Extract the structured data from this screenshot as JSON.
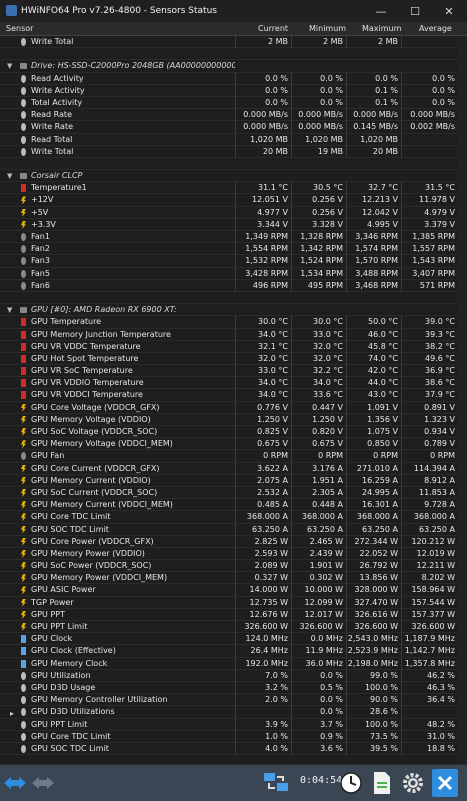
{
  "window": {
    "title": "HWiNFO64 Pro v7.26-4800 - Sensors Status"
  },
  "columns": {
    "sensor": "Sensor",
    "current": "Current",
    "minimum": "Minimum",
    "maximum": "Maximum",
    "average": "Average"
  },
  "rows": [
    {
      "t": "row",
      "icon": "circle",
      "name": "Write Total",
      "cur": "2 MB",
      "min": "2 MB",
      "max": "2 MB",
      "avg": ""
    },
    {
      "t": "blank"
    },
    {
      "t": "group",
      "icon": "drive",
      "name": "Drive: HS-SSD-C2000Pro 2048GB (AA000000000000000271)"
    },
    {
      "t": "row",
      "icon": "circle",
      "name": "Read Activity",
      "cur": "0.0 %",
      "min": "0.0 %",
      "max": "0.0 %",
      "avg": "0.0 %"
    },
    {
      "t": "row",
      "icon": "circle",
      "name": "Write Activity",
      "cur": "0.0 %",
      "min": "0.0 %",
      "max": "0.1 %",
      "avg": "0.0 %"
    },
    {
      "t": "row",
      "icon": "circle",
      "name": "Total Activity",
      "cur": "0.0 %",
      "min": "0.0 %",
      "max": "0.1 %",
      "avg": "0.0 %"
    },
    {
      "t": "row",
      "icon": "circle",
      "name": "Read Rate",
      "cur": "0.000 MB/s",
      "min": "0.000 MB/s",
      "max": "0.000 MB/s",
      "avg": "0.000 MB/s"
    },
    {
      "t": "row",
      "icon": "circle",
      "name": "Write Rate",
      "cur": "0.000 MB/s",
      "min": "0.000 MB/s",
      "max": "0.145 MB/s",
      "avg": "0.002 MB/s"
    },
    {
      "t": "row",
      "icon": "circle",
      "name": "Read Total",
      "cur": "1,020 MB",
      "min": "1,020 MB",
      "max": "1,020 MB",
      "avg": ""
    },
    {
      "t": "row",
      "icon": "circle",
      "name": "Write Total",
      "cur": "20 MB",
      "min": "19 MB",
      "max": "20 MB",
      "avg": ""
    },
    {
      "t": "blank"
    },
    {
      "t": "group",
      "icon": "drive",
      "name": "Corsair CLCP"
    },
    {
      "t": "row",
      "icon": "temp",
      "name": "Temperature1",
      "cur": "31.1 °C",
      "min": "30.5 °C",
      "max": "32.7 °C",
      "avg": "31.5 °C"
    },
    {
      "t": "row",
      "icon": "volt",
      "name": "+12V",
      "cur": "12.051 V",
      "min": "0.256 V",
      "max": "12.213 V",
      "avg": "11.978 V"
    },
    {
      "t": "row",
      "icon": "volt",
      "name": "+5V",
      "cur": "4.977 V",
      "min": "0.256 V",
      "max": "12.042 V",
      "avg": "4.979 V"
    },
    {
      "t": "row",
      "icon": "volt",
      "name": "+3.3V",
      "cur": "3.344 V",
      "min": "3.328 V",
      "max": "4.995 V",
      "avg": "3.379 V"
    },
    {
      "t": "row",
      "icon": "fan",
      "name": "Fan1",
      "cur": "1,349 RPM",
      "min": "1,328 RPM",
      "max": "3,346 RPM",
      "avg": "1,385 RPM"
    },
    {
      "t": "row",
      "icon": "fan",
      "name": "Fan2",
      "cur": "1,554 RPM",
      "min": "1,342 RPM",
      "max": "1,574 RPM",
      "avg": "1,557 RPM"
    },
    {
      "t": "row",
      "icon": "fan",
      "name": "Fan3",
      "cur": "1,532 RPM",
      "min": "1,524 RPM",
      "max": "1,570 RPM",
      "avg": "1,543 RPM"
    },
    {
      "t": "row",
      "icon": "fan",
      "name": "Fan5",
      "cur": "3,428 RPM",
      "min": "1,534 RPM",
      "max": "3,488 RPM",
      "avg": "3,407 RPM"
    },
    {
      "t": "row",
      "icon": "fan",
      "name": "Fan6",
      "cur": "496 RPM",
      "min": "495 RPM",
      "max": "3,468 RPM",
      "avg": "571 RPM"
    },
    {
      "t": "blank"
    },
    {
      "t": "group",
      "icon": "gpu",
      "name": "GPU [#0]: AMD Radeon RX 6900 XT:"
    },
    {
      "t": "row",
      "icon": "temp",
      "name": "GPU Temperature",
      "cur": "30.0 °C",
      "min": "30.0 °C",
      "max": "50.0 °C",
      "avg": "39.0 °C"
    },
    {
      "t": "row",
      "icon": "temp",
      "name": "GPU Memory Junction Temperature",
      "cur": "34.0 °C",
      "min": "33.0 °C",
      "max": "46.0 °C",
      "avg": "39.3 °C"
    },
    {
      "t": "row",
      "icon": "temp",
      "name": "GPU VR VDDC Temperature",
      "cur": "32.1 °C",
      "min": "32.0 °C",
      "max": "45.8 °C",
      "avg": "38.2 °C"
    },
    {
      "t": "row",
      "icon": "temp",
      "name": "GPU Hot Spot Temperature",
      "cur": "32.0 °C",
      "min": "32.0 °C",
      "max": "74.0 °C",
      "avg": "49.6 °C"
    },
    {
      "t": "row",
      "icon": "temp",
      "name": "GPU VR SoC Temperature",
      "cur": "33.0 °C",
      "min": "32.2 °C",
      "max": "42.0 °C",
      "avg": "36.9 °C"
    },
    {
      "t": "row",
      "icon": "temp",
      "name": "GPU VR VDDIO Temperature",
      "cur": "34.0 °C",
      "min": "34.0 °C",
      "max": "44.0 °C",
      "avg": "38.6 °C"
    },
    {
      "t": "row",
      "icon": "temp",
      "name": "GPU VR VDDCI Temperature",
      "cur": "34.0 °C",
      "min": "33.6 °C",
      "max": "43.0 °C",
      "avg": "37.9 °C"
    },
    {
      "t": "row",
      "icon": "volt",
      "name": "GPU Core Voltage (VDDCR_GFX)",
      "cur": "0.776 V",
      "min": "0.447 V",
      "max": "1.091 V",
      "avg": "0.891 V"
    },
    {
      "t": "row",
      "icon": "volt",
      "name": "GPU Memory Voltage (VDDIO)",
      "cur": "1.250 V",
      "min": "1.250 V",
      "max": "1.356 V",
      "avg": "1.323 V"
    },
    {
      "t": "row",
      "icon": "volt",
      "name": "GPU SoC Voltage (VDDCR_SOC)",
      "cur": "0.825 V",
      "min": "0.820 V",
      "max": "1.075 V",
      "avg": "0.934 V"
    },
    {
      "t": "row",
      "icon": "volt",
      "name": "GPU Memory Voltage (VDDCI_MEM)",
      "cur": "0.675 V",
      "min": "0.675 V",
      "max": "0.850 V",
      "avg": "0.789 V"
    },
    {
      "t": "row",
      "icon": "fan",
      "name": "GPU Fan",
      "cur": "0 RPM",
      "min": "0 RPM",
      "max": "0 RPM",
      "avg": "0 RPM"
    },
    {
      "t": "row",
      "icon": "volt",
      "name": "GPU Core Current (VDDCR_GFX)",
      "cur": "3.622 A",
      "min": "3.176 A",
      "max": "271.010 A",
      "avg": "114.394 A"
    },
    {
      "t": "row",
      "icon": "volt",
      "name": "GPU Memory Current (VDDIO)",
      "cur": "2.075 A",
      "min": "1.951 A",
      "max": "16.259 A",
      "avg": "8.912 A"
    },
    {
      "t": "row",
      "icon": "volt",
      "name": "GPU SoC Current (VDDCR_SOC)",
      "cur": "2.532 A",
      "min": "2.305 A",
      "max": "24.995 A",
      "avg": "11.853 A"
    },
    {
      "t": "row",
      "icon": "volt",
      "name": "GPU Memory Current (VDDCI_MEM)",
      "cur": "0.485 A",
      "min": "0.448 A",
      "max": "16.301 A",
      "avg": "9.728 A"
    },
    {
      "t": "row",
      "icon": "volt",
      "name": "GPU Core TDC Limit",
      "cur": "368.000 A",
      "min": "368.000 A",
      "max": "368.000 A",
      "avg": "368.000 A"
    },
    {
      "t": "row",
      "icon": "volt",
      "name": "GPU SOC TDC Limit",
      "cur": "63.250 A",
      "min": "63.250 A",
      "max": "63.250 A",
      "avg": "63.250 A"
    },
    {
      "t": "row",
      "icon": "volt",
      "name": "GPU Core Power (VDDCR_GFX)",
      "cur": "2.825 W",
      "min": "2.465 W",
      "max": "272.344 W",
      "avg": "120.212 W"
    },
    {
      "t": "row",
      "icon": "volt",
      "name": "GPU Memory Power (VDDIO)",
      "cur": "2.593 W",
      "min": "2.439 W",
      "max": "22.052 W",
      "avg": "12.019 W"
    },
    {
      "t": "row",
      "icon": "volt",
      "name": "GPU SoC Power (VDDCR_SOC)",
      "cur": "2.089 W",
      "min": "1.901 W",
      "max": "26.792 W",
      "avg": "12.211 W"
    },
    {
      "t": "row",
      "icon": "volt",
      "name": "GPU Memory Power (VDDCI_MEM)",
      "cur": "0.327 W",
      "min": "0.302 W",
      "max": "13.856 W",
      "avg": "8.202 W"
    },
    {
      "t": "row",
      "icon": "volt",
      "name": "GPU ASIC Power",
      "cur": "14.000 W",
      "min": "10.000 W",
      "max": "328.000 W",
      "avg": "158.964 W"
    },
    {
      "t": "row",
      "icon": "volt",
      "name": "TGP Power",
      "cur": "12.735 W",
      "min": "12.099 W",
      "max": "327.470 W",
      "avg": "157.544 W"
    },
    {
      "t": "row",
      "icon": "volt",
      "name": "GPU PPT",
      "cur": "12.676 W",
      "min": "12.017 W",
      "max": "326.616 W",
      "avg": "157.377 W"
    },
    {
      "t": "row",
      "icon": "volt",
      "name": "GPU PPT Limit",
      "cur": "326.600 W",
      "min": "326.600 W",
      "max": "326.600 W",
      "avg": "326.600 W"
    },
    {
      "t": "row",
      "icon": "clock",
      "name": "GPU Clock",
      "cur": "124.0 MHz",
      "min": "0.0 MHz",
      "max": "2,543.0 MHz",
      "avg": "1,187.9 MHz"
    },
    {
      "t": "row",
      "icon": "clock",
      "name": "GPU Clock (Effective)",
      "cur": "26.4 MHz",
      "min": "11.9 MHz",
      "max": "2,523.9 MHz",
      "avg": "1,142.7 MHz"
    },
    {
      "t": "row",
      "icon": "clock",
      "name": "GPU Memory Clock",
      "cur": "192.0 MHz",
      "min": "36.0 MHz",
      "max": "2,198.0 MHz",
      "avg": "1,357.8 MHz"
    },
    {
      "t": "row",
      "icon": "percent",
      "name": "GPU Utilization",
      "cur": "7.0 %",
      "min": "0.0 %",
      "max": "99.0 %",
      "avg": "46.2 %"
    },
    {
      "t": "row",
      "icon": "percent",
      "name": "GPU D3D Usage",
      "cur": "3.2 %",
      "min": "0.5 %",
      "max": "100.0 %",
      "avg": "46.3 %"
    },
    {
      "t": "row",
      "icon": "percent",
      "name": "GPU Memory Controller Utilization",
      "cur": "2.0 %",
      "min": "0.0 %",
      "max": "90.0 %",
      "avg": "36.4 %"
    },
    {
      "t": "row",
      "icon": "expand",
      "name": "GPU D3D Utilizations",
      "cur": "",
      "min": "0.0 %",
      "max": "28.6 %",
      "avg": ""
    },
    {
      "t": "row",
      "icon": "percent",
      "name": "GPU PPT Limit",
      "cur": "3.9 %",
      "min": "3.7 %",
      "max": "100.0 %",
      "avg": "48.2 %"
    },
    {
      "t": "row",
      "icon": "percent",
      "name": "GPU Core TDC Limit",
      "cur": "1.0 %",
      "min": "0.9 %",
      "max": "73.5 %",
      "avg": "31.0 %"
    },
    {
      "t": "row",
      "icon": "percent",
      "name": "GPU SOC TDC Limit",
      "cur": "4.0 %",
      "min": "3.6 %",
      "max": "39.5 %",
      "avg": "18.8 %"
    }
  ],
  "status": {
    "timer": "0:04:54"
  }
}
